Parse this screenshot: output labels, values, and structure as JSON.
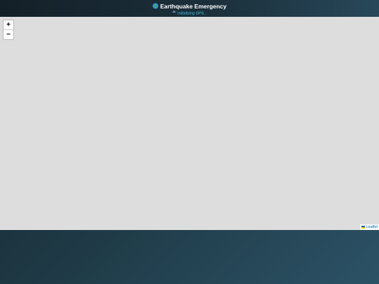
{
  "header": {
    "title": "Earthquake Emergency",
    "title_icon": "globe-icon",
    "status": "Initializing GPS...",
    "status_icon": "satellite-icon"
  },
  "map": {
    "zoom_in_label": "+",
    "zoom_out_label": "−",
    "attribution": "Leaflet",
    "attribution_icon": "ukraine-flag-icon"
  },
  "colors": {
    "header_bg": "#1b2f3a",
    "status_text": "#3fd0f0",
    "map_bg": "#dddddd",
    "link": "#0078a8"
  }
}
